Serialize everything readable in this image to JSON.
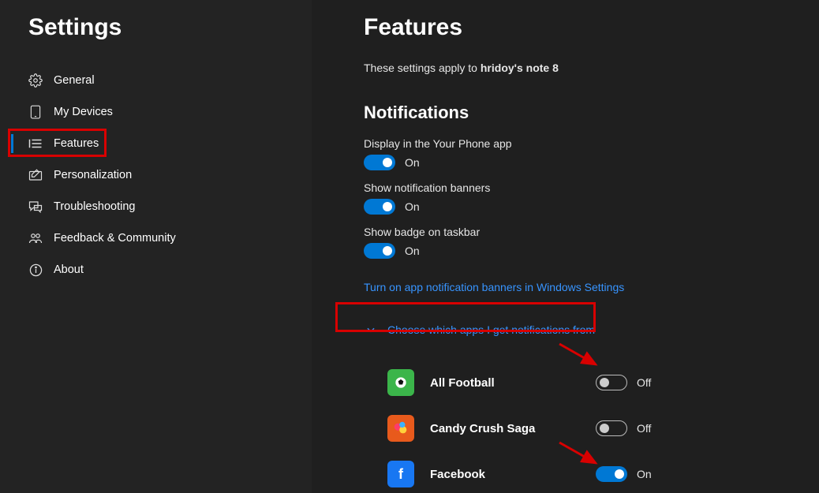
{
  "sidebar": {
    "title": "Settings",
    "items": [
      {
        "label": "General",
        "icon": "gear-icon"
      },
      {
        "label": "My Devices",
        "icon": "phone-icon"
      },
      {
        "label": "Features",
        "icon": "list-icon",
        "active": true
      },
      {
        "label": "Personalization",
        "icon": "edit-icon"
      },
      {
        "label": "Troubleshooting",
        "icon": "chat-icon"
      },
      {
        "label": "Feedback & Community",
        "icon": "people-icon"
      },
      {
        "label": "About",
        "icon": "info-icon"
      }
    ]
  },
  "main": {
    "title": "Features",
    "device_prefix": "These settings apply to ",
    "device_name": "hridoy's note 8",
    "section_title": "Notifications",
    "settings": [
      {
        "label": "Display in the Your Phone app",
        "on": true,
        "state": "On"
      },
      {
        "label": "Show notification banners",
        "on": true,
        "state": "On"
      },
      {
        "label": "Show badge on taskbar",
        "on": true,
        "state": "On"
      }
    ],
    "link_text": "Turn on app notification banners in Windows Settings",
    "dropdown_text": "Choose which apps I get notifications from",
    "apps": [
      {
        "name": "All Football",
        "on": false,
        "state": "Off",
        "color": "#3bb54a"
      },
      {
        "name": "Candy Crush Saga",
        "on": false,
        "state": "Off",
        "color": "#e85a1c"
      },
      {
        "name": "Facebook",
        "on": true,
        "state": "On",
        "color": "#1877f2"
      }
    ]
  }
}
